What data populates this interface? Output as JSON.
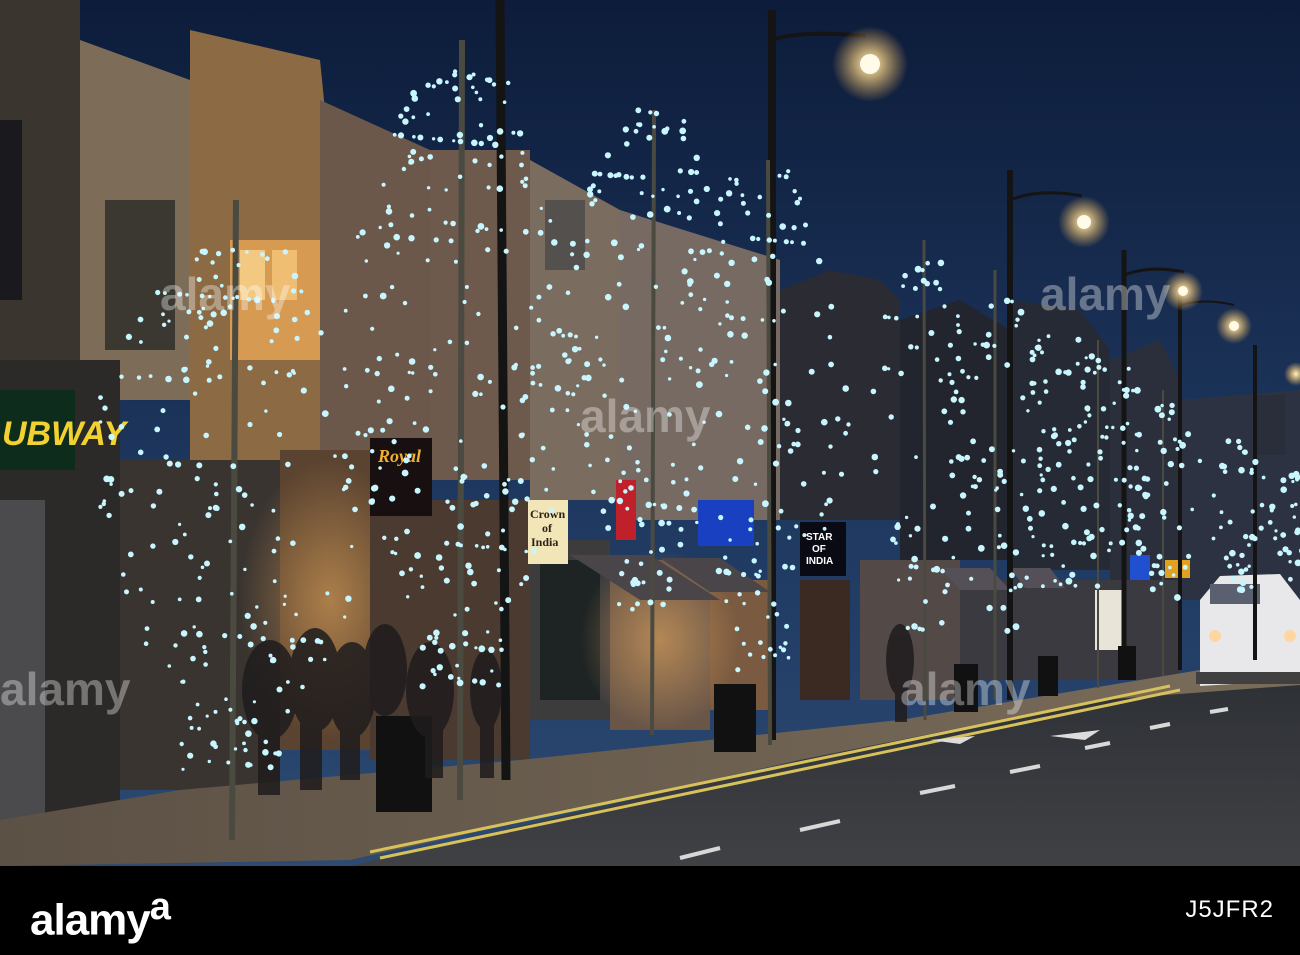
{
  "image": {
    "description_colors": {
      "sky_top": "#0e1e3d",
      "sky_bottom": "#24416b",
      "road": "#3b3c3f",
      "pavement": "#6a5d4e",
      "lights": "#bff4ff",
      "lamp": "#ffe9a8"
    }
  },
  "signs": {
    "subway": "UBWAY",
    "royal": "Royal",
    "crown_line1": "Crown",
    "crown_line2": "of",
    "crown_line3": "India",
    "star_line1": "STAR",
    "star_line2": "OF",
    "star_line3": "INDIA"
  },
  "watermark": {
    "text": "alamy"
  },
  "footer": {
    "brand": "alamy",
    "stock_id": "J5JFR2"
  }
}
